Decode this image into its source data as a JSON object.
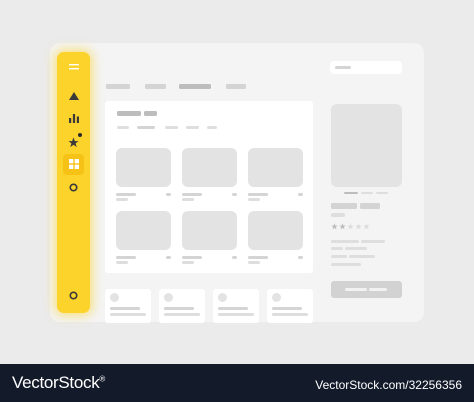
{
  "watermark": {
    "brand": "VectorStock",
    "registered_mark": "®",
    "url": "VectorStock.com/32256356"
  },
  "sidebar": {
    "active_index": 4,
    "items": [
      {
        "icon": "menu-icon"
      },
      {
        "icon": "triangle-icon"
      },
      {
        "icon": "bar-chart-icon"
      },
      {
        "icon": "star-icon",
        "badge": true
      },
      {
        "icon": "grid-icon",
        "active": true
      },
      {
        "icon": "circle-icon"
      },
      {
        "icon": "settings-icon"
      }
    ]
  },
  "colors": {
    "accent": "#fcd32a",
    "accent_active": "#f6c216",
    "window": "#f4f4f4",
    "background": "#ebebeb",
    "placeholder": "#e3e3e3",
    "footer": "#131a2a"
  },
  "detail": {
    "rating": 2,
    "rating_max": 5
  }
}
